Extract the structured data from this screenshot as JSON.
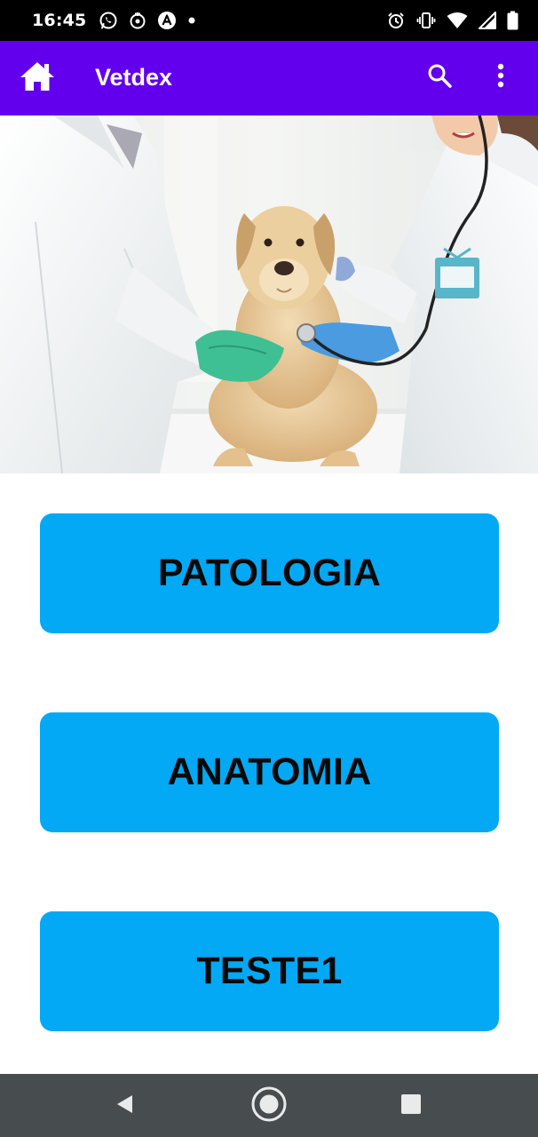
{
  "status_bar": {
    "time": "16:45",
    "left_icons": [
      "whatsapp-icon",
      "activity-icon",
      "app-a-icon",
      "notification-dot-icon"
    ],
    "right_icons": [
      "alarm-icon",
      "vibrate-icon",
      "wifi-icon",
      "signal-icon",
      "battery-icon"
    ]
  },
  "app_bar": {
    "title": "Vetdex",
    "background": "#6200ee",
    "icons": [
      "home-icon",
      "search-icon",
      "more-vert-icon"
    ]
  },
  "hero": {
    "image": "veterinarians-examining-labrador-puppy"
  },
  "menu": {
    "button_color": "#03a9f4",
    "buttons": [
      {
        "label": "PATOLOGIA"
      },
      {
        "label": "ANATOMIA"
      },
      {
        "label": "TESTE1"
      }
    ]
  },
  "nav_bar": {
    "background": "#474c4e",
    "icons": [
      "back-icon",
      "home-circle-icon",
      "recents-icon"
    ]
  }
}
